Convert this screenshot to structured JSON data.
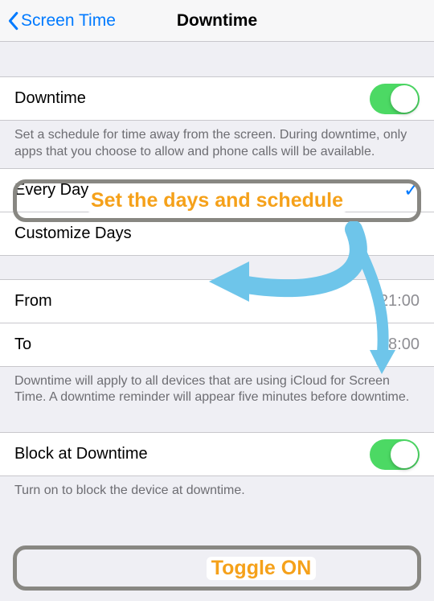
{
  "nav": {
    "back_label": "Screen Time",
    "title": "Downtime"
  },
  "section_downtime": {
    "label": "Downtime",
    "toggle_on": true,
    "footer": "Set a schedule for time away from the screen. During downtime, only apps that you choose to allow and phone calls will be available."
  },
  "section_schedule": {
    "every_day_label": "Every Day",
    "every_day_selected": true,
    "customize_label": "Customize Days"
  },
  "section_time": {
    "from_label": "From",
    "from_value": "21:00",
    "to_label": "To",
    "to_value": "08:00",
    "footer": "Downtime will apply to all devices that are using iCloud for Screen Time. A downtime reminder will appear five minutes before downtime."
  },
  "section_block": {
    "label": "Block at Downtime",
    "toggle_on": true,
    "footer": "Turn on to block the device at downtime."
  },
  "annotations": {
    "callout_schedule": "Set the days and schedule",
    "callout_toggle": "Toggle ON"
  }
}
